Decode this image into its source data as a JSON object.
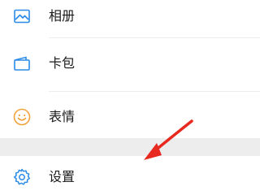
{
  "menu": {
    "items": [
      {
        "label": "相册",
        "icon": "image-icon"
      },
      {
        "label": "卡包",
        "icon": "card-wallet-icon"
      },
      {
        "label": "表情",
        "icon": "smiley-icon"
      },
      {
        "label": "设置",
        "icon": "gear-icon"
      }
    ]
  },
  "colors": {
    "icon_blue": "#2c8be8",
    "icon_orange": "#f2a23b",
    "annotation_red": "#e8291f",
    "section_gap": "#ededed"
  }
}
